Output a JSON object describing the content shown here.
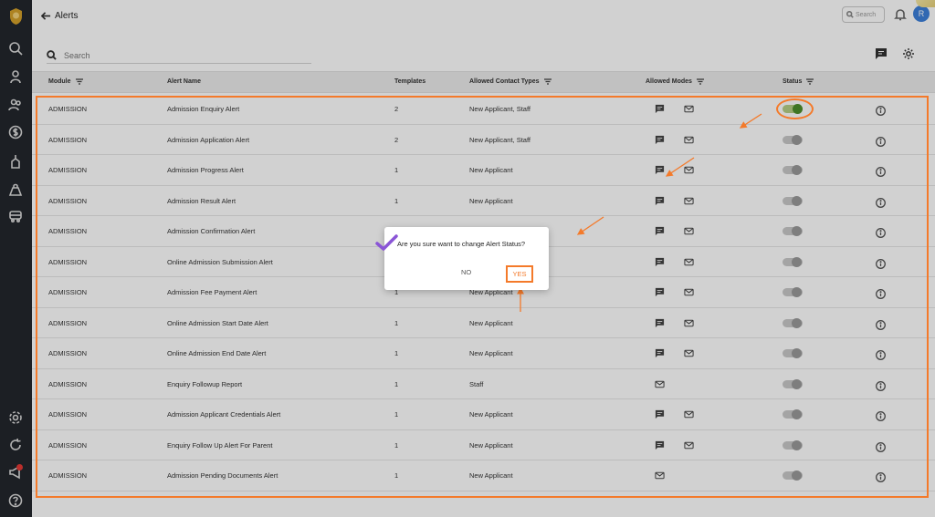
{
  "header": {
    "back_label": "Alerts",
    "search_placeholder": "Search",
    "avatar_initial": "R"
  },
  "toolbar": {
    "search_placeholder": "Search"
  },
  "table": {
    "columns": [
      "Module",
      "Alert Name",
      "Templates",
      "Allowed Contact Types",
      "Allowed Modes",
      "Status"
    ],
    "rows": [
      {
        "module": "ADMISSION",
        "name": "Admission Enquiry Alert",
        "templates": "2",
        "contacts": "New Applicant, Staff",
        "sms": true,
        "email": true,
        "status": true
      },
      {
        "module": "ADMISSION",
        "name": "Admission Application Alert",
        "templates": "2",
        "contacts": "New Applicant, Staff",
        "sms": true,
        "email": true,
        "status": false
      },
      {
        "module": "ADMISSION",
        "name": "Admission Progress Alert",
        "templates": "1",
        "contacts": "New Applicant",
        "sms": true,
        "email": true,
        "status": false
      },
      {
        "module": "ADMISSION",
        "name": "Admission Result Alert",
        "templates": "1",
        "contacts": "New Applicant",
        "sms": true,
        "email": true,
        "status": false
      },
      {
        "module": "ADMISSION",
        "name": "Admission Confirmation Alert",
        "templates": "",
        "contacts": "",
        "sms": true,
        "email": true,
        "status": false
      },
      {
        "module": "ADMISSION",
        "name": "Online Admission Submission Alert",
        "templates": "",
        "contacts": "",
        "sms": true,
        "email": true,
        "status": false
      },
      {
        "module": "ADMISSION",
        "name": "Admission Fee Payment Alert",
        "templates": "1",
        "contacts": "New Applicant",
        "sms": true,
        "email": true,
        "status": false
      },
      {
        "module": "ADMISSION",
        "name": "Online Admission Start Date Alert",
        "templates": "1",
        "contacts": "New Applicant",
        "sms": true,
        "email": true,
        "status": false
      },
      {
        "module": "ADMISSION",
        "name": "Online Admission End Date Alert",
        "templates": "1",
        "contacts": "New Applicant",
        "sms": true,
        "email": true,
        "status": false
      },
      {
        "module": "ADMISSION",
        "name": "Enquiry Followup Report",
        "templates": "1",
        "contacts": "Staff",
        "sms": false,
        "email": true,
        "status": false
      },
      {
        "module": "ADMISSION",
        "name": "Admission Applicant Credentials Alert",
        "templates": "1",
        "contacts": "New Applicant",
        "sms": true,
        "email": true,
        "status": false
      },
      {
        "module": "ADMISSION",
        "name": "Enquiry Follow Up Alert For Parent",
        "templates": "1",
        "contacts": "New Applicant",
        "sms": true,
        "email": true,
        "status": false
      },
      {
        "module": "ADMISSION",
        "name": "Admission Pending Documents Alert",
        "templates": "1",
        "contacts": "New Applicant",
        "sms": false,
        "email": true,
        "status": false
      }
    ]
  },
  "dialog": {
    "message": "Are you sure want to change Alert Status?",
    "no_label": "NO",
    "yes_label": "YES"
  },
  "sidebar": {
    "icons": [
      "search-icon",
      "student-icon",
      "users-icon",
      "fees-icon",
      "hand-icon",
      "bag-icon",
      "transport-icon",
      "settings-icon",
      "refresh-icon",
      "megaphone-icon",
      "help-icon"
    ]
  },
  "colors": {
    "accent": "#f47a2a",
    "toggle_on": "#4e8f2c",
    "sidebar_bg": "#23262d"
  }
}
